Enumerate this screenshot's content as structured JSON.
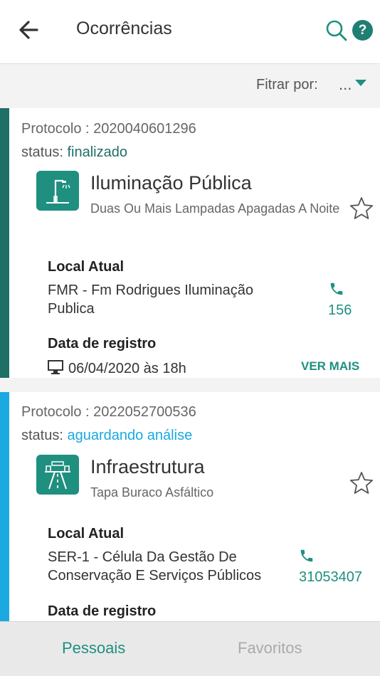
{
  "header": {
    "title": "Ocorrências"
  },
  "filter": {
    "label": "Fitrar por:",
    "value": "..."
  },
  "colors": {
    "accent": "#1f8f80",
    "stripe_finalizado": "#1f6f66",
    "stripe_aguardando": "#1aa9e0"
  },
  "occurrences": [
    {
      "protocol": "Protocolo : 2020040601296",
      "status_label": "status:",
      "status_value": "finalizado",
      "category_icon": "street-light-icon",
      "category": "Iluminação Pública",
      "subcategory": "Duas Ou Mais Lampadas Apagadas A Noite",
      "local_label": "Local Atual",
      "local_value": "FMR - Fm Rodrigues Iluminação Publica",
      "phone": "156",
      "date_label": "Data de registro",
      "date_value": "06/04/2020 às 18h",
      "more_label": "VER MAIS"
    },
    {
      "protocol": "Protocolo : 2022052700536",
      "status_label": "status:",
      "status_value": "aguardando análise",
      "category_icon": "road-infrastructure-icon",
      "category": "Infraestrutura",
      "subcategory": "Tapa Buraco Asfáltico",
      "local_label": "Local Atual",
      "local_value": "SER-1 - Célula Da Gestão De Conservação E Serviços Públicos",
      "phone": "31053407",
      "date_label": "Data de registro"
    }
  ],
  "tabs": [
    {
      "label": "Pessoais",
      "active": true
    },
    {
      "label": "Favoritos",
      "active": false
    }
  ]
}
